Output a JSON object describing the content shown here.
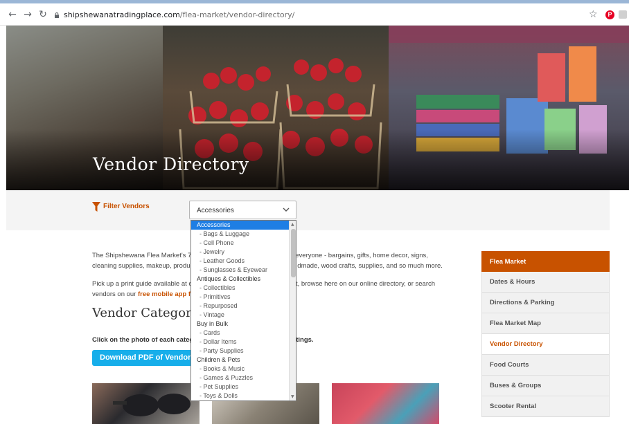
{
  "browser": {
    "url_host": "shipshewanatradingplace.com",
    "url_path": "/flea-market/vendor-directory/",
    "pinterest_icon": "P"
  },
  "hero": {
    "title": "Vendor Directory"
  },
  "filter": {
    "label": "Filter Vendors",
    "selected": "Accessories"
  },
  "dropdown": {
    "options": [
      {
        "label": "Accessories",
        "sub": false
      },
      {
        "label": "- Bags & Luggage",
        "sub": true
      },
      {
        "label": "- Cell Phone",
        "sub": true
      },
      {
        "label": "- Jewelry",
        "sub": true
      },
      {
        "label": "- Leather Goods",
        "sub": true
      },
      {
        "label": "- Sunglasses & Eyewear",
        "sub": true
      },
      {
        "label": "Antiques & Collectibles",
        "sub": false
      },
      {
        "label": "- Collectibles",
        "sub": true
      },
      {
        "label": "- Primitives",
        "sub": true
      },
      {
        "label": "- Repurposed",
        "sub": true
      },
      {
        "label": "- Vintage",
        "sub": true
      },
      {
        "label": "Buy in Bulk",
        "sub": false
      },
      {
        "label": "- Cards",
        "sub": true
      },
      {
        "label": "- Dollar Items",
        "sub": true
      },
      {
        "label": "- Party Supplies",
        "sub": true
      },
      {
        "label": "Children & Pets",
        "sub": false
      },
      {
        "label": "- Books & Music",
        "sub": true
      },
      {
        "label": "- Games & Puzzles",
        "sub": true
      },
      {
        "label": "- Pet Supplies",
        "sub": true
      },
      {
        "label": "- Toys & Dolls",
        "sub": true
      }
    ]
  },
  "main": {
    "intro_start": "The Shipshewana Flea Market's 70",
    "intro_mid": " everyone - bargains, gifts, home decor, signs,",
    "intro_line2_start": "cleaning supplies, makeup, produc",
    "intro_line2_end": "dmade, wood crafts, supplies, and so much more.",
    "guide_start": "Pick up a print guide available at e",
    "guide_mid": "et, browse here on our online directory, or search",
    "guide_line2": "vendors on our ",
    "guide_link": "free mobile app fo",
    "section_title": "Vendor Categori",
    "click_note_start": "Click on the photo of each categ",
    "click_note_end": "tings.",
    "pdf_button": "Download PDF of Vendor Di"
  },
  "sidebar": {
    "items": [
      {
        "label": "Flea Market",
        "state": "head"
      },
      {
        "label": "Dates & Hours",
        "state": "normal"
      },
      {
        "label": "Directions & Parking",
        "state": "normal"
      },
      {
        "label": "Flea Market Map",
        "state": "normal"
      },
      {
        "label": "Vendor Directory",
        "state": "active"
      },
      {
        "label": "Food Courts",
        "state": "normal"
      },
      {
        "label": "Buses & Groups",
        "state": "normal"
      },
      {
        "label": "Scooter Rental",
        "state": "normal"
      }
    ]
  },
  "colors": {
    "accent": "#c85200",
    "button_blue": "#17aeea",
    "selection_blue": "#1e7ee4"
  }
}
